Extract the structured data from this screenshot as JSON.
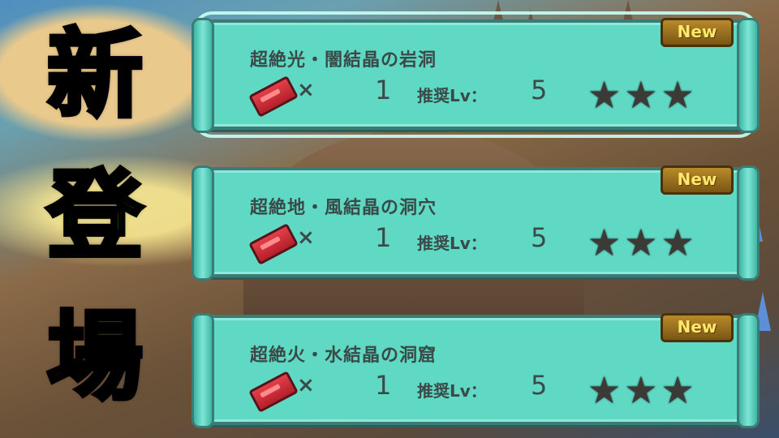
{
  "headline_chars": [
    "新",
    "登",
    "場"
  ],
  "quests": [
    {
      "title": "超絶光・闇結晶の岩洞",
      "badge": "New",
      "times": "×",
      "quantity": "1",
      "level_label": "推奨Lv：",
      "level": "5",
      "stars": "★★★",
      "star_count": 3
    },
    {
      "title": "超絶地・風結晶の洞穴",
      "badge": "New",
      "times": "×",
      "quantity": "1",
      "level_label": "推奨Lv：",
      "level": "5",
      "stars": "★★★",
      "star_count": 3
    },
    {
      "title": "超絶火・水結晶の洞窟",
      "badge": "New",
      "times": "×",
      "quantity": "1",
      "level_label": "推奨Lv：",
      "level": "5",
      "stars": "★★★",
      "star_count": 3
    }
  ],
  "icons": {
    "ticket": "ticket-icon",
    "star": "star-icon"
  },
  "colors": {
    "card": "#5fd8c4",
    "card_border": "#3c7c76",
    "badge": "#b98a2a",
    "star": "#3b3a36"
  }
}
